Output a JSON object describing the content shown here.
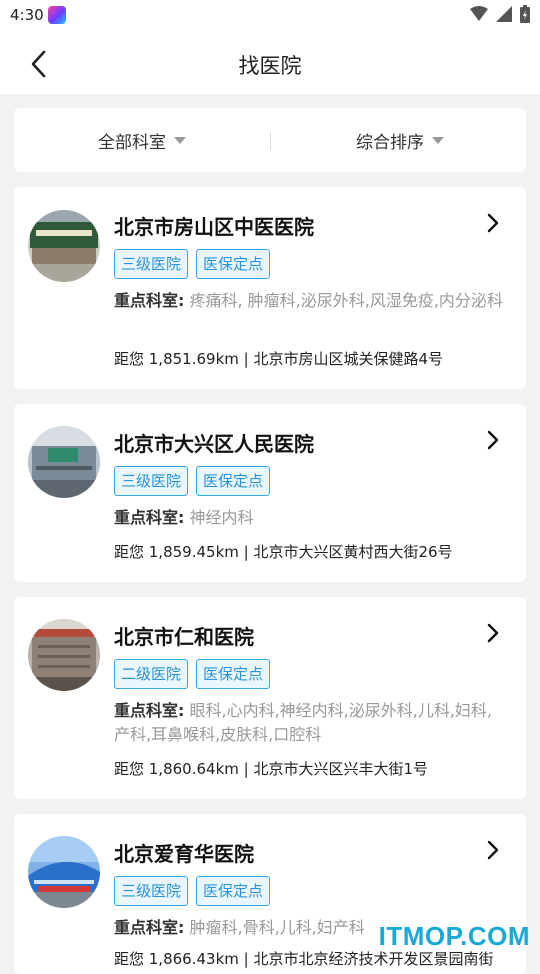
{
  "status": {
    "time": "4:30"
  },
  "header": {
    "title": "找医院"
  },
  "filters": {
    "department": "全部科室",
    "sort": "综合排序"
  },
  "labels": {
    "key_departments": "重点科室:"
  },
  "hospitals": [
    {
      "name": "北京市房山区中医医院",
      "tags": [
        "三级医院",
        "医保定点"
      ],
      "departments": "疼痛科, 肿瘤科,泌尿外科,风湿免疫,内分泌科",
      "distance_address": "距您 1,851.69km | 北京市房山区城关保健路4号"
    },
    {
      "name": "北京市大兴区人民医院",
      "tags": [
        "三级医院",
        "医保定点"
      ],
      "departments": "神经内科",
      "distance_address": "距您 1,859.45km | 北京市大兴区黄村西大街26号"
    },
    {
      "name": "北京市仁和医院",
      "tags": [
        "二级医院",
        "医保定点"
      ],
      "departments": "眼科,心内科,神经内科,泌尿外科,儿科,妇科,产科,耳鼻喉科,皮肤科,口腔科",
      "distance_address": "距您 1,860.64km | 北京市大兴区兴丰大街1号"
    },
    {
      "name": "北京爱育华医院",
      "tags": [
        "三级医院",
        "医保定点"
      ],
      "departments": "肿瘤科,骨科,儿科,妇产科",
      "distance_address": "距您 1,866.43km | 北京市北京经济技术开发区景园南街"
    }
  ],
  "watermark": "ITMOP.COM",
  "colors": {
    "tag_border": "#3aa6e6",
    "tag_text": "#2b94d8",
    "watermark": "#19a9d8"
  }
}
